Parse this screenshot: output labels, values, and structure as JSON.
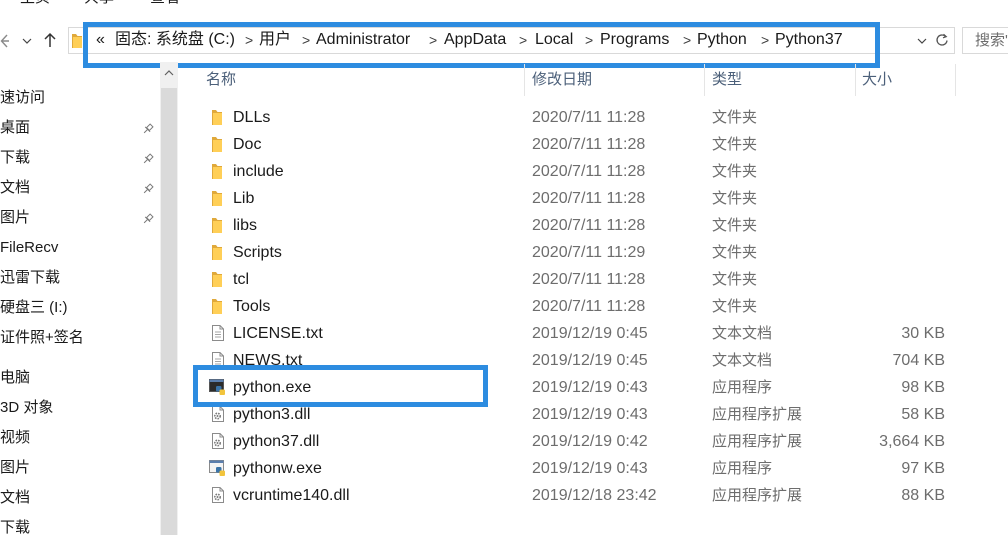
{
  "ribbon": {
    "tabs": [
      {
        "label": "主页"
      },
      {
        "label": "共享"
      },
      {
        "label": "查看"
      }
    ]
  },
  "toolbar": {
    "back_icon": "back-arrow-icon",
    "recent_icon": "chevron-down-icon",
    "up_icon": "up-arrow-icon",
    "refresh_icon": "refresh-icon"
  },
  "address": {
    "overflow": "«",
    "separator": ">",
    "crumbs": [
      "固态: 系统盘 (C:)",
      "用户",
      "Administrator",
      "AppData",
      "Local",
      "Programs",
      "Python",
      "Python37"
    ]
  },
  "search": {
    "placeholder": "搜索'"
  },
  "sidebar": {
    "items": [
      {
        "label": "速访问",
        "pinned": false
      },
      {
        "label": "桌面",
        "pinned": true
      },
      {
        "label": "下载",
        "pinned": true
      },
      {
        "label": "文档",
        "pinned": true
      },
      {
        "label": "图片",
        "pinned": true
      },
      {
        "label": "FileRecv",
        "pinned": false
      },
      {
        "label": "迅雷下载",
        "pinned": false
      },
      {
        "label": "硬盘三 (I:)",
        "pinned": false
      },
      {
        "label": "证件照+签名",
        "pinned": false
      },
      {
        "label": "电脑",
        "pinned": false
      },
      {
        "label": "3D 对象",
        "pinned": false
      },
      {
        "label": "视频",
        "pinned": false
      },
      {
        "label": "图片",
        "pinned": false
      },
      {
        "label": "文档",
        "pinned": false
      },
      {
        "label": "下载",
        "pinned": false
      }
    ]
  },
  "columns": {
    "name": "名称",
    "modified": "修改日期",
    "type": "类型",
    "size": "大小"
  },
  "files": [
    {
      "name": "DLLs",
      "modified": "2020/7/11 11:28",
      "type": "文件夹",
      "size": "",
      "icon": "folder-icon"
    },
    {
      "name": "Doc",
      "modified": "2020/7/11 11:28",
      "type": "文件夹",
      "size": "",
      "icon": "folder-icon"
    },
    {
      "name": "include",
      "modified": "2020/7/11 11:28",
      "type": "文件夹",
      "size": "",
      "icon": "folder-icon"
    },
    {
      "name": "Lib",
      "modified": "2020/7/11 11:28",
      "type": "文件夹",
      "size": "",
      "icon": "folder-icon"
    },
    {
      "name": "libs",
      "modified": "2020/7/11 11:28",
      "type": "文件夹",
      "size": "",
      "icon": "folder-icon"
    },
    {
      "name": "Scripts",
      "modified": "2020/7/11 11:29",
      "type": "文件夹",
      "size": "",
      "icon": "folder-icon"
    },
    {
      "name": "tcl",
      "modified": "2020/7/11 11:28",
      "type": "文件夹",
      "size": "",
      "icon": "folder-icon"
    },
    {
      "name": "Tools",
      "modified": "2020/7/11 11:28",
      "type": "文件夹",
      "size": "",
      "icon": "folder-icon"
    },
    {
      "name": "LICENSE.txt",
      "modified": "2019/12/19 0:45",
      "type": "文本文档",
      "size": "30 KB",
      "icon": "text-file-icon"
    },
    {
      "name": "NEWS.txt",
      "modified": "2019/12/19 0:45",
      "type": "文本文档",
      "size": "704 KB",
      "icon": "text-file-icon"
    },
    {
      "name": "python.exe",
      "modified": "2019/12/19 0:43",
      "type": "应用程序",
      "size": "98 KB",
      "icon": "python-exe-icon",
      "highlighted": true
    },
    {
      "name": "python3.dll",
      "modified": "2019/12/19 0:43",
      "type": "应用程序扩展",
      "size": "58 KB",
      "icon": "dll-file-icon"
    },
    {
      "name": "python37.dll",
      "modified": "2019/12/19 0:42",
      "type": "应用程序扩展",
      "size": "3,664 KB",
      "icon": "dll-file-icon"
    },
    {
      "name": "pythonw.exe",
      "modified": "2019/12/19 0:43",
      "type": "应用程序",
      "size": "97 KB",
      "icon": "pythonw-exe-icon"
    },
    {
      "name": "vcruntime140.dll",
      "modified": "2019/12/18 23:42",
      "type": "应用程序扩展",
      "size": "88 KB",
      "icon": "dll-file-icon"
    }
  ],
  "colors": {
    "highlight": "#2d8ce0",
    "folder": "#ffcf57",
    "header_text": "#4c607a",
    "secondary_text": "#6d6d6d"
  }
}
